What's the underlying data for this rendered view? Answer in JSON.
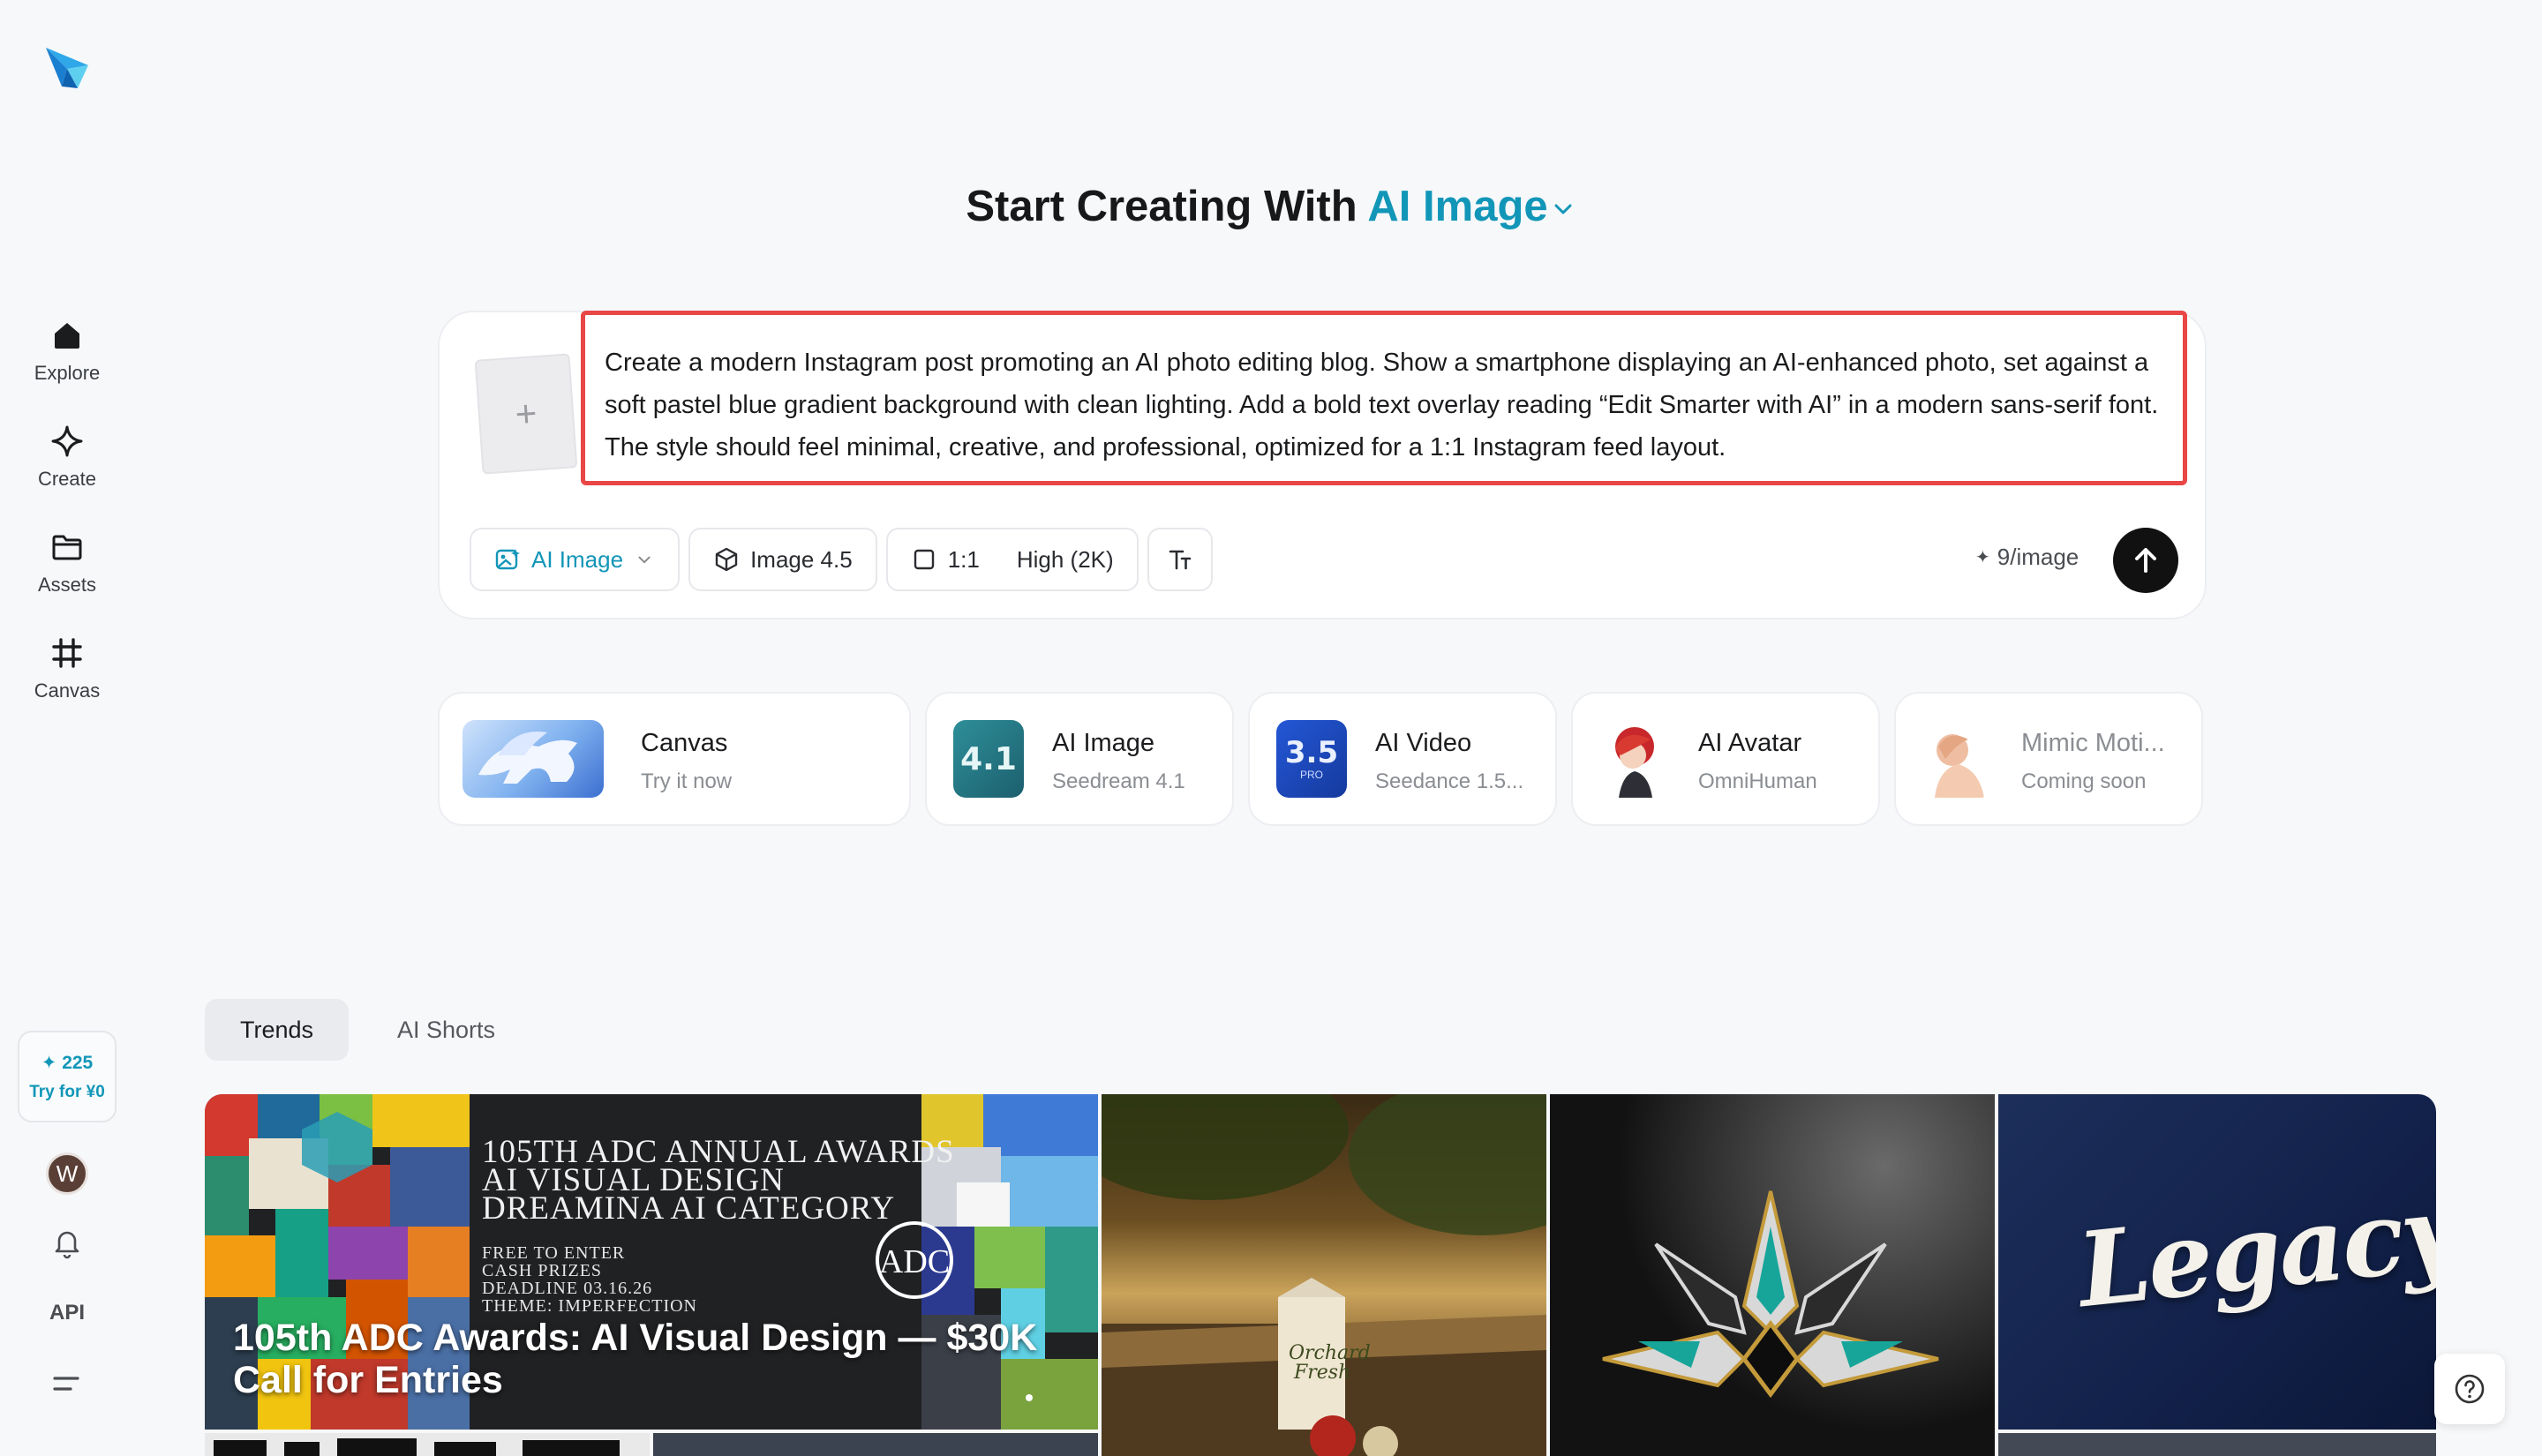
{
  "sidebar": {
    "items": [
      {
        "label": "Explore",
        "icon": "home-icon"
      },
      {
        "label": "Create",
        "icon": "sparkle-icon"
      },
      {
        "label": "Assets",
        "icon": "folder-icon"
      },
      {
        "label": "Canvas",
        "icon": "frame-icon"
      }
    ],
    "credits": {
      "amount": "✦ 225",
      "try_label": "Try for ¥0"
    },
    "avatar_initial": "W",
    "api_label": "API"
  },
  "header": {
    "title_prefix": "Start Creating With",
    "title_mode": "AI Image"
  },
  "prompt": {
    "text": "Create a modern Instagram post promoting an AI photo editing blog. Show a smartphone displaying an AI-enhanced photo, set against a soft pastel blue gradient background with clean lighting. Add a bold text overlay reading “Edit Smarter with AI” in a modern sans-serif font. The style should feel minimal, creative, and professional, optimized for a 1:1 Instagram feed layout.",
    "add_reference_symbol": "+"
  },
  "toolbar": {
    "mode_label": "AI Image",
    "model_label": "Image 4.5",
    "ratio_label": "1:1",
    "quality_label": "High (2K)",
    "cost_label": "9/image"
  },
  "features": [
    {
      "title": "Canvas",
      "subtitle": "Try it now"
    },
    {
      "title": "AI Image",
      "subtitle": "Seedream 4.1",
      "badge": "4.1"
    },
    {
      "title": "AI Video",
      "subtitle": "Seedance 1.5...",
      "badge": "3.5",
      "badge_sub": "PRO"
    },
    {
      "title": "AI Avatar",
      "subtitle": "OmniHuman"
    },
    {
      "title": "Mimic Moti...",
      "subtitle": "Coming soon"
    }
  ],
  "tabs": [
    {
      "label": "Trends",
      "active": true
    },
    {
      "label": "AI Shorts",
      "active": false
    }
  ],
  "gallery": {
    "banner": {
      "title": "105th ADC Awards: AI Visual Design — $30K Call for Entries",
      "lines": [
        "105TH ADC ANNUAL AWARDS",
        "AI VISUAL DESIGN",
        "DREAMINA AI CATEGORY"
      ],
      "small_lines": [
        "FREE TO ENTER",
        "CASH PRIZES",
        "DEADLINE 03.16.26",
        "THEME: IMPERFECTION"
      ],
      "logo_text": "ADC"
    },
    "carton_text": [
      "Orchard",
      "Fresh"
    ],
    "legacy_text": "Legacy"
  },
  "colors": {
    "accent": "#1296b8",
    "highlight_border": "#e94646",
    "background": "#f7f8fa"
  }
}
